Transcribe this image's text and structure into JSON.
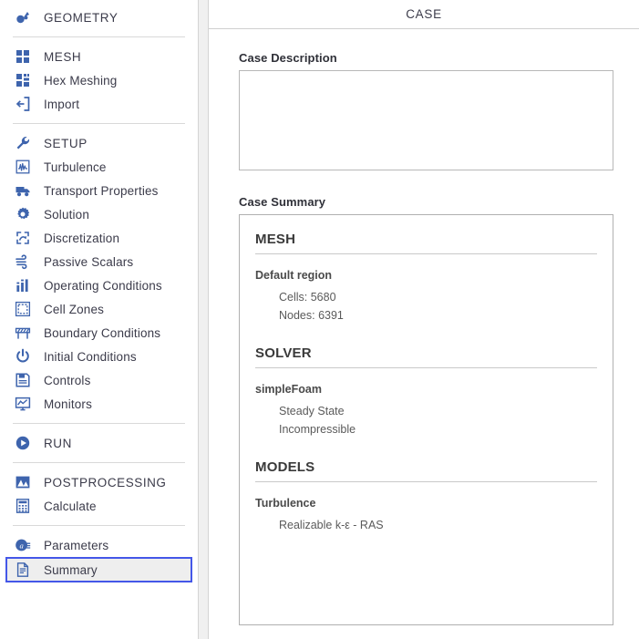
{
  "sidebar": {
    "groups": [
      {
        "items": [
          {
            "label": "GEOMETRY",
            "icon": "geometry-icon",
            "header": true,
            "selected": false
          }
        ]
      },
      {
        "items": [
          {
            "label": "MESH",
            "icon": "mesh-grid-icon",
            "header": true,
            "selected": false
          },
          {
            "label": "Hex Meshing",
            "icon": "hex-meshing-icon",
            "header": false,
            "selected": false
          },
          {
            "label": "Import",
            "icon": "import-icon",
            "header": false,
            "selected": false
          }
        ]
      },
      {
        "items": [
          {
            "label": "SETUP",
            "icon": "wrench-icon",
            "header": true,
            "selected": false
          },
          {
            "label": "Turbulence",
            "icon": "turbulence-waveform-icon",
            "header": false,
            "selected": false
          },
          {
            "label": "Transport Properties",
            "icon": "truck-icon",
            "header": false,
            "selected": false
          },
          {
            "label": "Solution",
            "icon": "gear-icon",
            "header": false,
            "selected": false
          },
          {
            "label": "Discretization",
            "icon": "discretization-icon",
            "header": false,
            "selected": false
          },
          {
            "label": "Passive Scalars",
            "icon": "wind-icon",
            "header": false,
            "selected": false
          },
          {
            "label": "Operating Conditions",
            "icon": "bar-chart-icon",
            "header": false,
            "selected": false
          },
          {
            "label": "Cell Zones",
            "icon": "dashed-square-icon",
            "header": false,
            "selected": false
          },
          {
            "label": "Boundary Conditions",
            "icon": "barrier-icon",
            "header": false,
            "selected": false
          },
          {
            "label": "Initial Conditions",
            "icon": "power-icon",
            "header": false,
            "selected": false
          },
          {
            "label": "Controls",
            "icon": "save-disk-icon",
            "header": false,
            "selected": false
          },
          {
            "label": "Monitors",
            "icon": "monitor-chart-icon",
            "header": false,
            "selected": false
          }
        ]
      },
      {
        "items": [
          {
            "label": "RUN",
            "icon": "play-circle-icon",
            "header": true,
            "selected": false
          }
        ]
      },
      {
        "items": [
          {
            "label": "POSTPROCESSING",
            "icon": "image-mountain-icon",
            "header": true,
            "selected": false
          },
          {
            "label": "Calculate",
            "icon": "calculator-icon",
            "header": false,
            "selected": false
          }
        ]
      },
      {
        "items": [
          {
            "label": "Parameters",
            "icon": "at-parameters-icon",
            "header": false,
            "selected": false
          },
          {
            "label": "Summary",
            "icon": "document-icon",
            "header": false,
            "selected": true
          }
        ]
      }
    ]
  },
  "content": {
    "header_title": "CASE",
    "description": {
      "label": "Case Description",
      "value": "",
      "placeholder": ""
    },
    "summary": {
      "label": "Case Summary",
      "sections": [
        {
          "title": "MESH",
          "subtitle": "Default region",
          "lines": [
            "Cells: 5680",
            "Nodes: 6391"
          ]
        },
        {
          "title": "SOLVER",
          "subtitle": "simpleFoam",
          "lines": [
            "Steady State",
            "Incompressible"
          ]
        },
        {
          "title": "MODELS",
          "subtitle": "Turbulence",
          "lines": [
            "Realizable k-ε - RAS"
          ]
        }
      ]
    }
  },
  "colors": {
    "accent": "#3e64ad",
    "selection_border": "#4457e8",
    "selection_fill": "#eeeeee",
    "text": "#3b3b4a",
    "panel_border": "#d4d4d4"
  }
}
